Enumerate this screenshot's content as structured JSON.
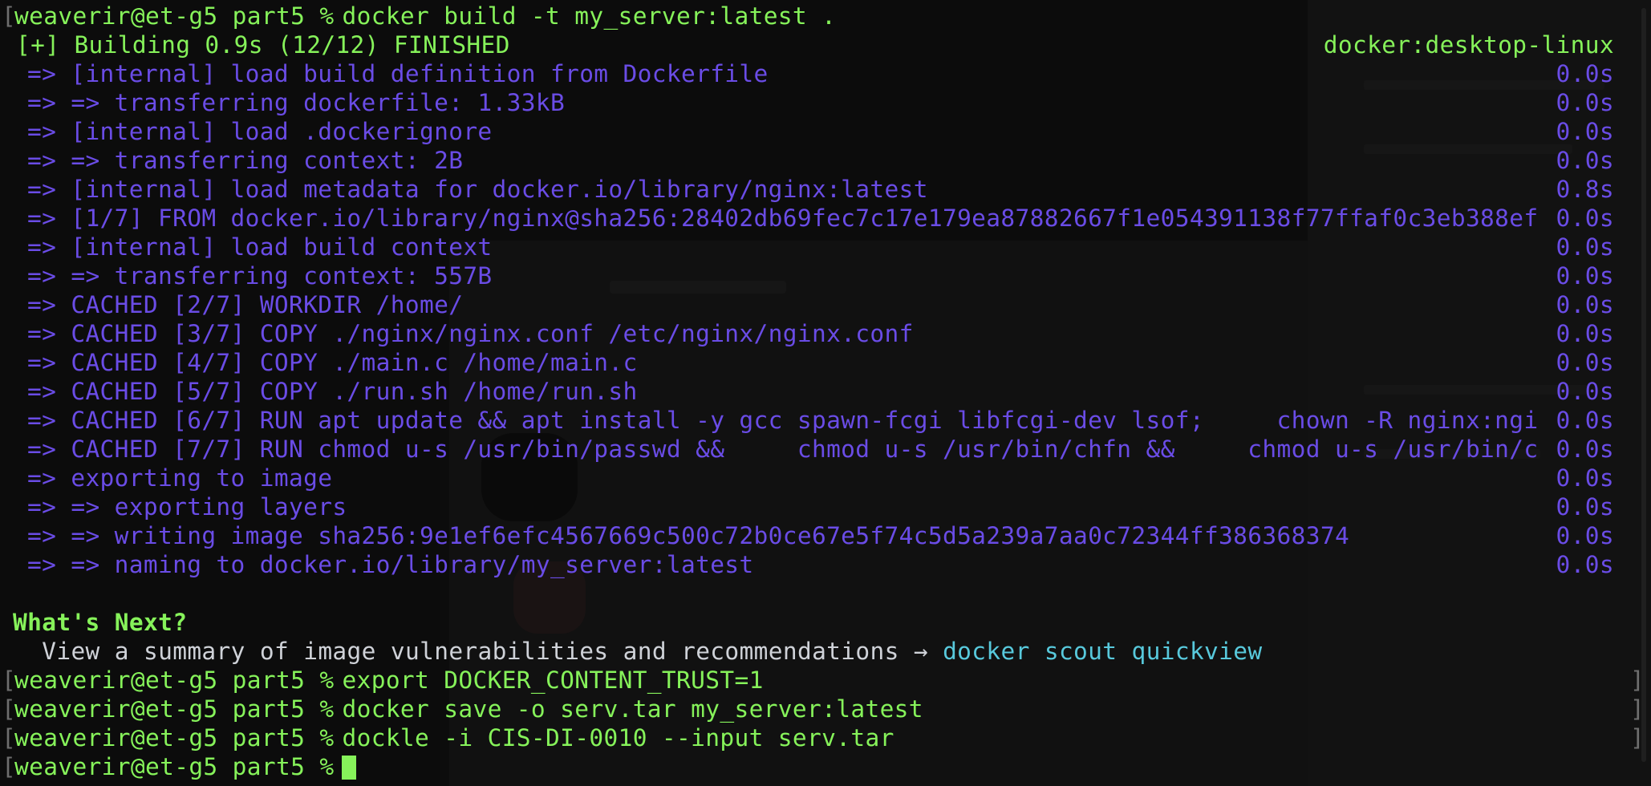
{
  "terminal": {
    "prompt": "weaverir@et-g5 part5 %",
    "lines": [
      {
        "kind": "cmd",
        "text": "docker build -t my_server:latest ."
      },
      {
        "kind": "header",
        "text": "[+] Building 0.9s (12/12) FINISHED",
        "right": "docker:desktop-linux"
      },
      {
        "kind": "step",
        "text": "=> [internal] load build definition from Dockerfile",
        "time": "0.0s"
      },
      {
        "kind": "step",
        "text": "=> => transferring dockerfile: 1.33kB",
        "time": "0.0s"
      },
      {
        "kind": "step",
        "text": "=> [internal] load .dockerignore",
        "time": "0.0s"
      },
      {
        "kind": "step",
        "text": "=> => transferring context: 2B",
        "time": "0.0s"
      },
      {
        "kind": "step",
        "text": "=> [internal] load metadata for docker.io/library/nginx:latest",
        "time": "0.8s"
      },
      {
        "kind": "step",
        "text": "=> [1/7] FROM docker.io/library/nginx@sha256:28402db69fec7c17e179ea87882667f1e054391138f77ffaf0c3eb388ef",
        "time": "0.0s"
      },
      {
        "kind": "step",
        "text": "=> [internal] load build context",
        "time": "0.0s"
      },
      {
        "kind": "step",
        "text": "=> => transferring context: 557B",
        "time": "0.0s"
      },
      {
        "kind": "step",
        "text": "=> CACHED [2/7] WORKDIR /home/",
        "time": "0.0s"
      },
      {
        "kind": "step",
        "text": "=> CACHED [3/7] COPY ./nginx/nginx.conf /etc/nginx/nginx.conf",
        "time": "0.0s"
      },
      {
        "kind": "step",
        "text": "=> CACHED [4/7] COPY ./main.c /home/main.c",
        "time": "0.0s"
      },
      {
        "kind": "step",
        "text": "=> CACHED [5/7] COPY ./run.sh /home/run.sh",
        "time": "0.0s"
      },
      {
        "kind": "step",
        "text": "=> CACHED [6/7] RUN apt update && apt install -y gcc spawn-fcgi libfcgi-dev lsof;     chown -R nginx:ngi",
        "time": "0.0s"
      },
      {
        "kind": "step",
        "text": "=> CACHED [7/7] RUN chmod u-s /usr/bin/passwd &&     chmod u-s /usr/bin/chfn &&     chmod u-s /usr/bin/c",
        "time": "0.0s"
      },
      {
        "kind": "step",
        "text": "=> exporting to image",
        "time": "0.0s"
      },
      {
        "kind": "step",
        "text": "=> => exporting layers",
        "time": "0.0s"
      },
      {
        "kind": "step",
        "text": "=> => writing image sha256:9e1ef6efc4567669c500c72b0ce67e5f74c5d5a239a7aa0c72344ff386368374",
        "time": "0.0s"
      },
      {
        "kind": "step",
        "text": "=> => naming to docker.io/library/my_server:latest",
        "time": "0.0s"
      },
      {
        "kind": "blank"
      },
      {
        "kind": "next-title",
        "text": "What's Next?"
      },
      {
        "kind": "next-item",
        "text": "  View a summary of image vulnerabilities and recommendations → ",
        "cmd": "docker scout quickview"
      },
      {
        "kind": "cmd",
        "text": "export DOCKER_CONTENT_TRUST=1"
      },
      {
        "kind": "cmd",
        "text": "docker save -o serv.tar my_server:latest"
      },
      {
        "kind": "cmd",
        "text": "dockle -i CIS-DI-0010 --input serv.tar"
      },
      {
        "kind": "cursor"
      }
    ]
  },
  "colors": {
    "background": "#0d0d0d",
    "prompt_green": "#86f25a",
    "step_purple": "#6a4ce6",
    "plain_text": "#cfd2d8",
    "link_cyan": "#58c9dc"
  }
}
